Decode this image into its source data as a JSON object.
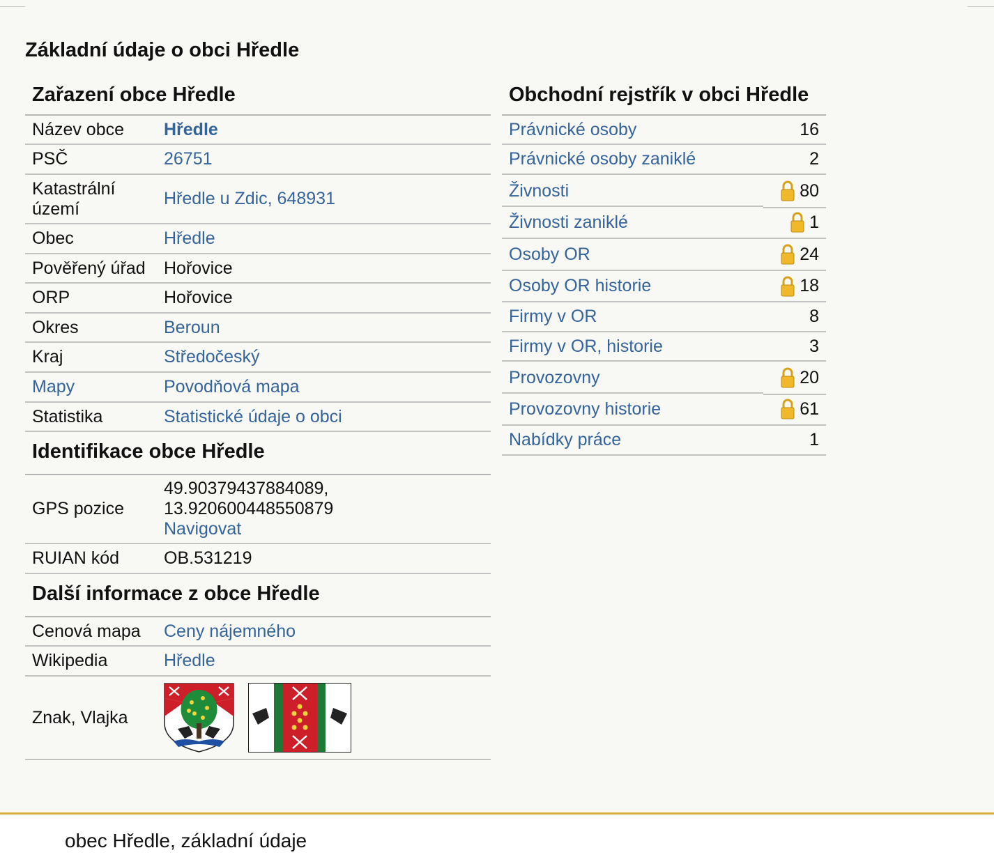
{
  "page_title": "Základní údaje o obci Hředle",
  "classification": {
    "heading": "Zařazení obce Hředle",
    "rows": [
      {
        "label": "Název obce",
        "value": "Hředle",
        "link": true,
        "bold": true
      },
      {
        "label": "PSČ",
        "value": "26751",
        "link": true
      },
      {
        "label": "Katastrální území",
        "value": "Hředle u Zdic, 648931",
        "link": true
      },
      {
        "label": "Obec",
        "value": "Hředle",
        "link": true
      },
      {
        "label": "Pověřený úřad",
        "value": "Hořovice",
        "link": false
      },
      {
        "label": "ORP",
        "value": "Hořovice",
        "link": false
      },
      {
        "label": "Okres",
        "value": "Beroun",
        "link": true
      },
      {
        "label": "Kraj",
        "value": "Středočeský",
        "link": true
      },
      {
        "label": "Mapy",
        "value": "Povodňová mapa",
        "link": true
      },
      {
        "label": "Statistika",
        "value": "Statistické údaje o obci",
        "link": true
      }
    ]
  },
  "identification": {
    "heading": "Identifikace obce Hředle",
    "gps_label": "GPS pozice",
    "gps_lat": "49.90379437884089,",
    "gps_lon": "13.920600448550879",
    "navigate_label": "Navigovat",
    "ruian_label": "RUIAN kód",
    "ruian_value": "OB.531219"
  },
  "more_info": {
    "heading": "Další informace z obce Hředle",
    "price_map_label": "Cenová mapa",
    "price_map_value": "Ceny nájemného",
    "wikipedia_label": "Wikipedia",
    "wikipedia_value": "Hředle",
    "emblem_label": "Znak, Vlajka"
  },
  "business_register": {
    "heading": "Obchodní rejstřík v obci Hředle",
    "rows": [
      {
        "label": "Právnické osoby",
        "count": "16",
        "locked": false
      },
      {
        "label": "Právnické osoby zaniklé",
        "count": "2",
        "locked": false
      },
      {
        "label": "Živnosti",
        "count": "80",
        "locked": true
      },
      {
        "label": "Živnosti zaniklé",
        "count": "1",
        "locked": true
      },
      {
        "label": "Osoby OR",
        "count": "24",
        "locked": true
      },
      {
        "label": "Osoby OR historie",
        "count": "18",
        "locked": true
      },
      {
        "label": "Firmy v OR",
        "count": "8",
        "locked": false
      },
      {
        "label": "Firmy v OR, historie",
        "count": "3",
        "locked": false
      },
      {
        "label": "Provozovny",
        "count": "20",
        "locked": true
      },
      {
        "label": "Provozovny historie",
        "count": "61",
        "locked": true
      },
      {
        "label": "Nabídky práce",
        "count": "1",
        "locked": false
      }
    ]
  },
  "footer": {
    "text": "obec Hředle, základní údaje"
  },
  "colors": {
    "link": "#35649b",
    "footer_accent": "#d8ae3c",
    "background": "#f8f8f4"
  }
}
